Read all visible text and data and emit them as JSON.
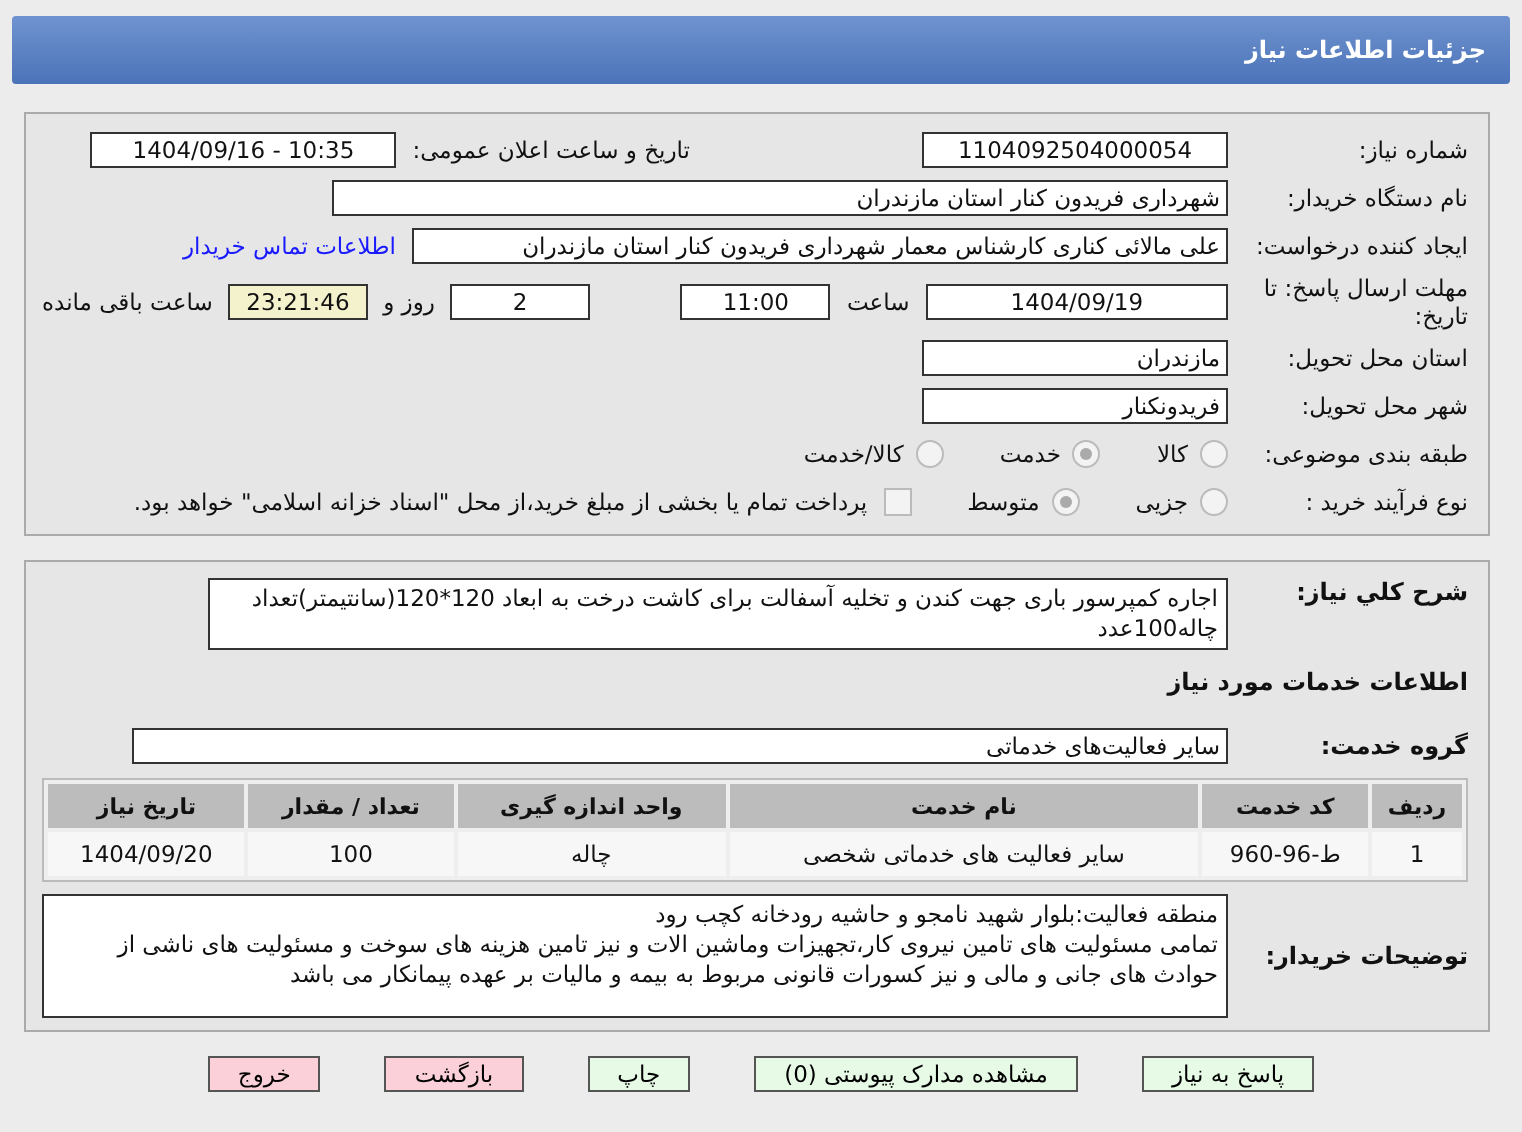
{
  "header": {
    "title": "جزئیات اطلاعات نیاز"
  },
  "need_number": {
    "label": "شماره نیاز:",
    "value": "1104092504000054"
  },
  "announce": {
    "label": "تاریخ و ساعت اعلان عمومی:",
    "value": "1404/09/16 - 10:35"
  },
  "buyer": {
    "label": "نام دستگاه خریدار:",
    "value": "شهرداری فریدون کنار استان مازندران"
  },
  "creator": {
    "label": "ایجاد کننده درخواست:",
    "value": "علی مالائی کناری کارشناس معمار شهرداری فریدون کنار استان مازندران",
    "link": "اطلاعات تماس خریدار"
  },
  "deadline": {
    "label": "مهلت ارسال پاسخ: تا تاریخ:",
    "date": "1404/09/19",
    "time_label": "ساعت",
    "time": "11:00",
    "days": "2",
    "days_label": "روز و",
    "remaining": "23:21:46",
    "remaining_label": "ساعت باقی مانده"
  },
  "province": {
    "label": "استان محل تحویل:",
    "value": "مازندران"
  },
  "city": {
    "label": "شهر محل تحویل:",
    "value": "فریدونکنار"
  },
  "category": {
    "label": "طبقه بندی موضوعی:",
    "options": [
      {
        "label": "کالا",
        "selected": false
      },
      {
        "label": "خدمت",
        "selected": true
      },
      {
        "label": "کالا/خدمت",
        "selected": false
      }
    ]
  },
  "process": {
    "label": "نوع فرآیند خرید :",
    "options": [
      {
        "label": "جزیی",
        "selected": false
      },
      {
        "label": "متوسط",
        "selected": true
      }
    ],
    "treasury": {
      "checked": false,
      "text": "پرداخت تمام یا بخشی از مبلغ خرید،از محل \"اسناد خزانه اسلامی\" خواهد بود."
    }
  },
  "description": {
    "label": "شرح کلي نياز:",
    "value": "اجاره کمپرسور باری جهت کندن و تخلیه آسفالت برای کاشت درخت به ابعاد 120*120(سانتیمتر)تعداد چاله100عدد"
  },
  "services_heading": "اطلاعات خدمات مورد نياز",
  "service_group": {
    "label": "گروه خدمت:",
    "value": "سایر فعالیت‌های خدماتی"
  },
  "table": {
    "columns": [
      "ردیف",
      "کد خدمت",
      "نام خدمت",
      "واحد اندازه گیری",
      "تعداد / مقدار",
      "تاریخ نیاز"
    ],
    "rows": [
      [
        "1",
        "ط-96-960",
        "سایر فعالیت های خدماتی شخصی",
        "چاله",
        "100",
        "1404/09/20"
      ]
    ]
  },
  "buyer_notes": {
    "label": "توضیحات خریدار:",
    "lines": [
      "منطقه فعالیت:بلوار شهید نامجو و حاشیه رودخانه کچب رود",
      "تمامی مسئولیت های تامین نیروی کار،تجهیزات وماشین الات و نیز تامین هزینه های سوخت و مسئولیت های ناشی از حوادث های جانی و مالی و نیز کسورات قانونی مربوط به بیمه و مالیات بر عهده پیمانکار می باشد"
    ]
  },
  "buttons": [
    {
      "label": "پاسخ به نیاز",
      "kind": "primary"
    },
    {
      "label": "مشاهده مدارک پیوستی (0)",
      "kind": "primary"
    },
    {
      "label": "چاپ",
      "kind": "primary"
    },
    {
      "label": "بازگشت",
      "kind": "danger"
    },
    {
      "label": "خروج",
      "kind": "danger"
    }
  ]
}
